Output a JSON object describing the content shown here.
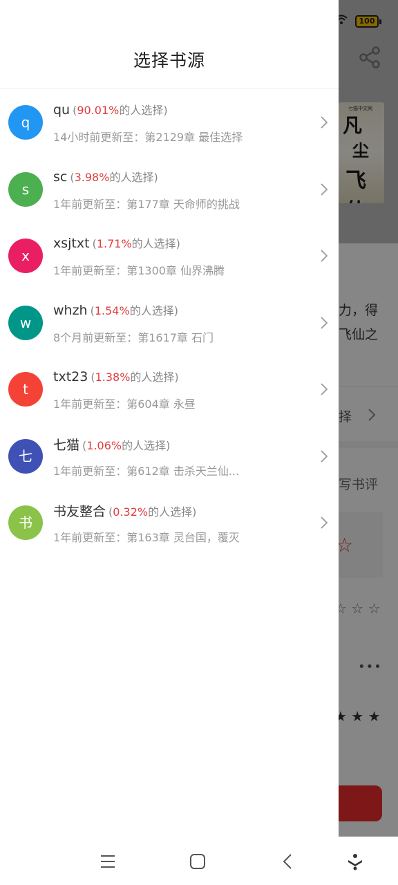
{
  "status_bar": {
    "battery_level": "100",
    "icons": [
      "wifi-icon",
      "battery-icon"
    ]
  },
  "drawer": {
    "title": "选择书源",
    "pct_suffix": "的人选择",
    "update_suffix": "前更新至：",
    "sources": [
      {
        "avatar": "q",
        "avatar_color": "#2196f3",
        "name": "qu",
        "percent": "90.01%",
        "updated": "14小时",
        "chapter": "第2129章 最佳选择"
      },
      {
        "avatar": "s",
        "avatar_color": "#4caf50",
        "name": "sc",
        "percent": "3.98%",
        "updated": "1年",
        "chapter": "第177章 天命师的挑战"
      },
      {
        "avatar": "x",
        "avatar_color": "#e91e63",
        "name": "xsjtxt",
        "percent": "1.71%",
        "updated": "1年",
        "chapter": "第1300章 仙界沸腾"
      },
      {
        "avatar": "w",
        "avatar_color": "#009688",
        "name": "whzh",
        "percent": "1.54%",
        "updated": "8个月",
        "chapter": "第1617章 石门"
      },
      {
        "avatar": "t",
        "avatar_color": "#f44336",
        "name": "txt23",
        "percent": "1.38%",
        "updated": "1年",
        "chapter": "第604章 永昼"
      },
      {
        "avatar": "七",
        "avatar_color": "#3f51b5",
        "name": "七猫",
        "percent": "1.06%",
        "updated": "1年",
        "chapter": "第612章  击杀天兰仙..."
      },
      {
        "avatar": "书",
        "avatar_color": "#8bc34a",
        "name": "书友整合",
        "percent": "0.32%",
        "updated": "1年",
        "chapter": "第163章 灵台国，覆灭"
      }
    ]
  },
  "background": {
    "text_1": "力，得",
    "text_2": "飞仙之",
    "text_3": "择",
    "text_4": "写书评",
    "cover_text": [
      "凡",
      "尘",
      "飞仙"
    ],
    "cover_tag": "七猫中文网"
  },
  "navbar": {
    "buttons": [
      "menu-icon",
      "home-icon",
      "back-icon",
      "accessibility-icon"
    ]
  }
}
